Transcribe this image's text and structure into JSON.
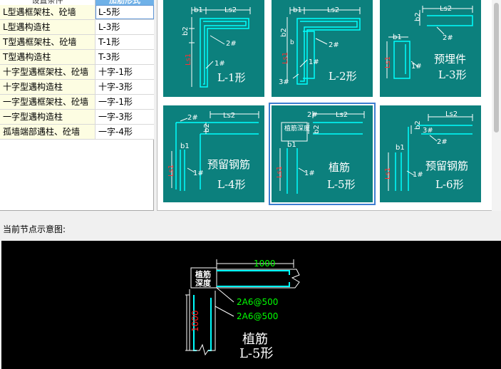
{
  "table": {
    "header": {
      "condition": "设置条件",
      "form": "加筋形式"
    },
    "rows": [
      {
        "condition": "L型遇框架柱、砼墙",
        "form": "L-5形"
      },
      {
        "condition": "L型遇构造柱",
        "form": "L-3形"
      },
      {
        "condition": "T型遇框架柱、砼墙",
        "form": "T-1形"
      },
      {
        "condition": "T型遇构造柱",
        "form": "T-3形"
      },
      {
        "condition": "十字型遇框架柱、砼墙",
        "form": "十字-1形"
      },
      {
        "condition": "十字型遇构造柱",
        "form": "十字-3形"
      },
      {
        "condition": "一字型遇框架柱、砼墙",
        "form": "一字-1形"
      },
      {
        "condition": "一字型遇构造柱",
        "form": "一字-3形"
      },
      {
        "condition": "孤墙端部遇柱、砼墙",
        "form": "一字-4形"
      }
    ]
  },
  "gallery": {
    "items": [
      {
        "name": "L-1形",
        "extra": ""
      },
      {
        "name": "L-2形",
        "extra": ""
      },
      {
        "name": "L-3形",
        "extra": "预埋件"
      },
      {
        "name": "L-4形",
        "extra": "预留钢筋"
      },
      {
        "name": "L-5形",
        "extra": "植筋"
      },
      {
        "name": "L-6形",
        "extra": "预留钢筋"
      }
    ],
    "labels": {
      "b1": "b1",
      "b2": "b2",
      "ls1": "Ls1",
      "ls2": "Ls2",
      "r1": "1#",
      "r2": "2#",
      "r3": "3#",
      "b": "b",
      "plant_depth": "植筋深度"
    },
    "selected": "L-5形"
  },
  "preview": {
    "section_label": "当前节点示意图:",
    "dim_top": "1000",
    "dim_left": "1000",
    "rebar_1": "2A6@500",
    "rebar_2": "2A6@500",
    "depth_label_1": "植筋",
    "depth_label_2": "深度",
    "title": "植筋",
    "subtitle": "L-5形"
  },
  "colors": {
    "teal": "#0c807d",
    "rebar": "#00ffff",
    "dim_green": "#00ff00",
    "dim_red": "#ff2020",
    "select": "#3c7dd0"
  }
}
